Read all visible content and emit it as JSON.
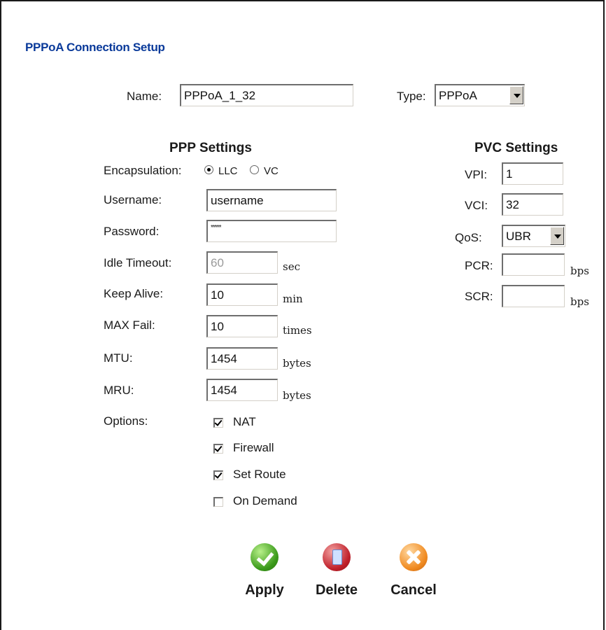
{
  "page": {
    "title": "PPPoA Connection Setup"
  },
  "top": {
    "name_label": "Name:",
    "name_value": "PPPoA_1_32",
    "type_label": "Type:",
    "type_value": "PPPoA"
  },
  "ppp": {
    "heading": "PPP Settings",
    "encapsulation_label": "Encapsulation:",
    "encapsulation_options": [
      "LLC",
      "VC"
    ],
    "encapsulation_selected": "LLC",
    "username_label": "Username:",
    "username_value": "username",
    "password_label": "Password:",
    "password_value": "*****",
    "idle_timeout_label": "Idle Timeout:",
    "idle_timeout_value": "60",
    "idle_timeout_unit": "sec",
    "keep_alive_label": "Keep Alive:",
    "keep_alive_value": "10",
    "keep_alive_unit": "min",
    "max_fail_label": "MAX Fail:",
    "max_fail_value": "10",
    "max_fail_unit": "times",
    "mtu_label": "MTU:",
    "mtu_value": "1454",
    "mtu_unit": "bytes",
    "mru_label": "MRU:",
    "mru_value": "1454",
    "mru_unit": "bytes",
    "options_label": "Options:",
    "options": [
      {
        "label": "NAT",
        "checked": true
      },
      {
        "label": "Firewall",
        "checked": true
      },
      {
        "label": "Set Route",
        "checked": true
      },
      {
        "label": "On Demand",
        "checked": false
      }
    ]
  },
  "pvc": {
    "heading": "PVC Settings",
    "vpi_label": "VPI:",
    "vpi_value": "1",
    "vci_label": "VCI:",
    "vci_value": "32",
    "qos_label": "QoS:",
    "qos_value": "UBR",
    "pcr_label": "PCR:",
    "pcr_value": "",
    "pcr_unit": "bps",
    "scr_label": "SCR:",
    "scr_value": "",
    "scr_unit": "bps"
  },
  "buttons": {
    "apply": "Apply",
    "delete": "Delete",
    "cancel": "Cancel"
  },
  "icons": {
    "apply": "check-icon",
    "delete": "trash-icon",
    "cancel": "close-icon"
  }
}
